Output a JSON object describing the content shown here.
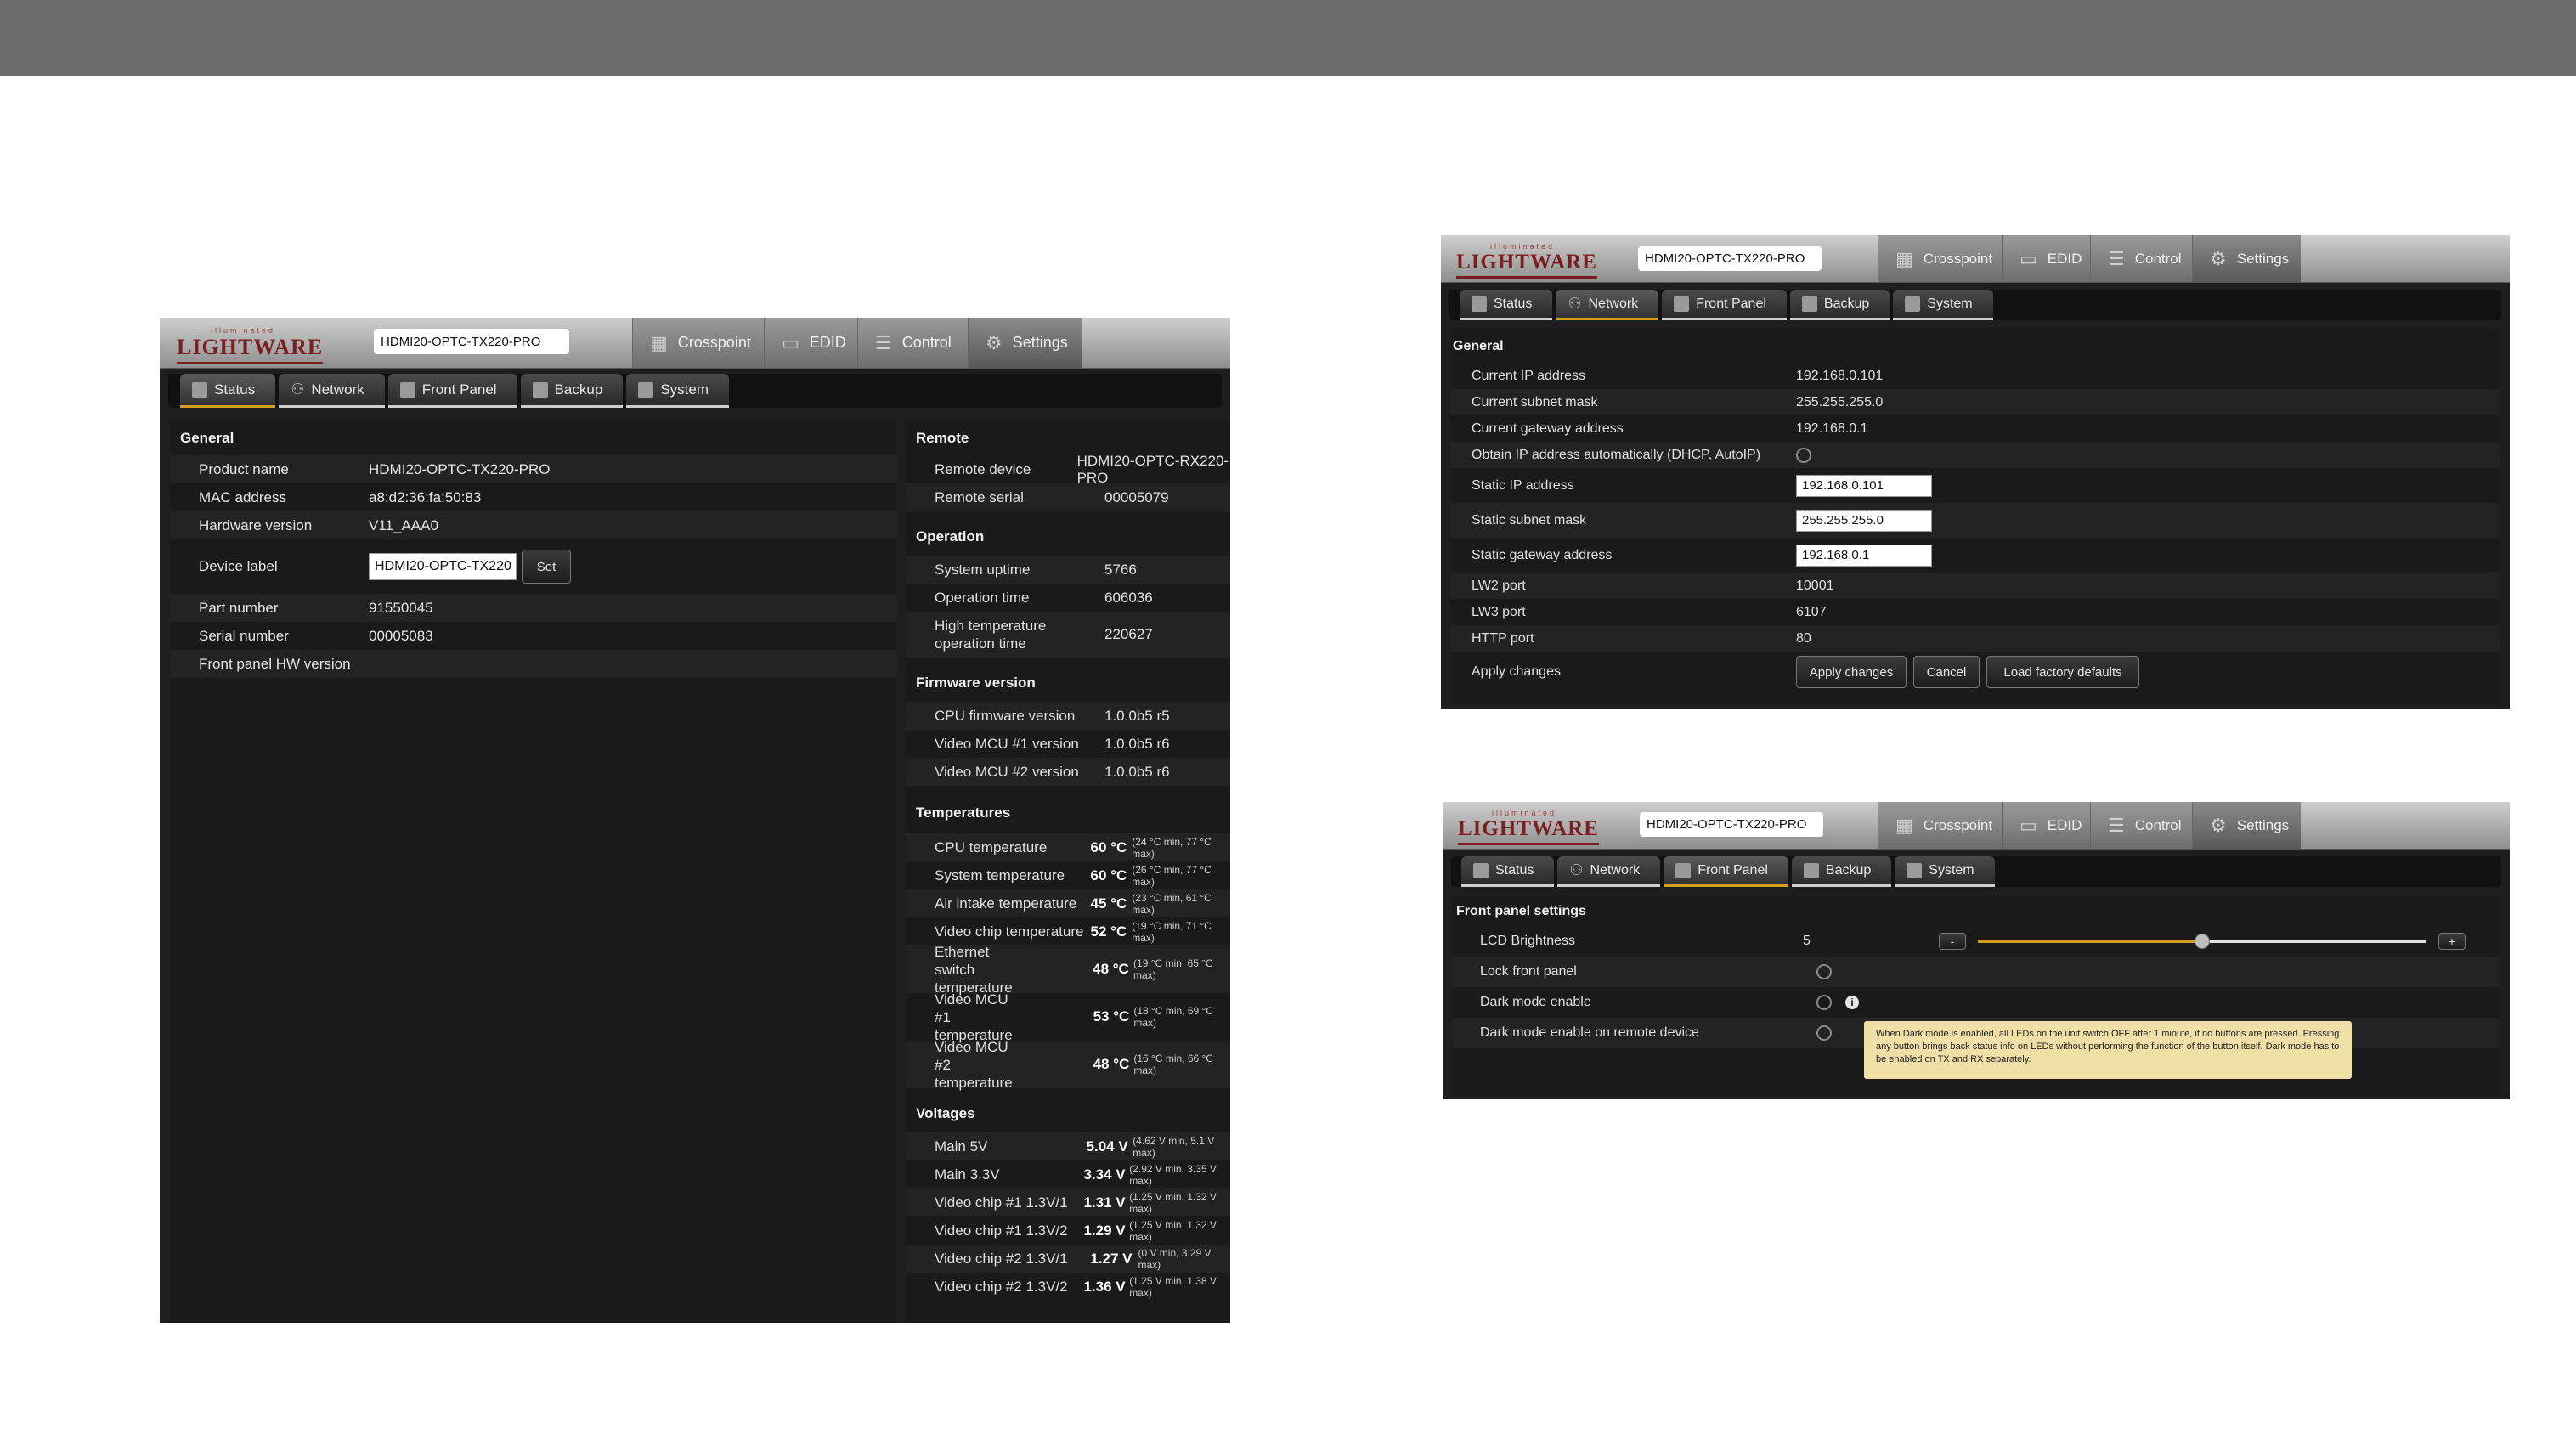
{
  "logo": {
    "tag": "illuminated",
    "name": "LIGHTWARE"
  },
  "device_name": "HDMI20-OPTC-TX220-PRO",
  "nav": [
    "Crosspoint",
    "EDID",
    "Control",
    "Settings"
  ],
  "subtabs": [
    "Status",
    "Network",
    "Front Panel",
    "Backup",
    "System"
  ],
  "status": {
    "general": {
      "title": "General",
      "rows": [
        {
          "label": "Product name",
          "value": "HDMI20-OPTC-TX220-PRO"
        },
        {
          "label": "MAC address",
          "value": "a8:d2:36:fa:50:83"
        },
        {
          "label": "Hardware version",
          "value": "V11_AAA0"
        },
        {
          "label": "Device label",
          "value": "HDMI20-OPTC-TX220",
          "button": "Set"
        },
        {
          "label": "Part number",
          "value": "91550045"
        },
        {
          "label": "Serial number",
          "value": "00005083"
        },
        {
          "label": "Front panel HW version",
          "value": ""
        }
      ]
    },
    "remote": {
      "title": "Remote",
      "rows": [
        {
          "label": "Remote device",
          "value": "HDMI20-OPTC-RX220-PRO"
        },
        {
          "label": "Remote serial",
          "value": "00005079"
        }
      ]
    },
    "operation": {
      "title": "Operation",
      "rows": [
        {
          "label": "System uptime",
          "value": "5766"
        },
        {
          "label": "Operation time",
          "value": "606036"
        },
        {
          "label": "High temperature operation time",
          "value": "220627"
        }
      ]
    },
    "firmware": {
      "title": "Firmware version",
      "rows": [
        {
          "label": "CPU firmware version",
          "value": "1.0.0b5 r5"
        },
        {
          "label": "Video MCU #1 version",
          "value": "1.0.0b5 r6"
        },
        {
          "label": "Video MCU #2 version",
          "value": "1.0.0b5 r6"
        }
      ]
    },
    "temperatures": {
      "title": "Temperatures",
      "rows": [
        {
          "label": "CPU temperature",
          "value": "60 °C",
          "range": "(24 °C min, 77 °C max)"
        },
        {
          "label": "System temperature",
          "value": "60 °C",
          "range": "(26 °C min, 77 °C max)"
        },
        {
          "label": "Air intake temperature",
          "value": "45 °C",
          "range": "(23 °C min, 61 °C max)"
        },
        {
          "label": "Video chip temperature",
          "value": "52 °C",
          "range": "(19 °C min, 71 °C max)"
        },
        {
          "label": "Ethernet switch temperature",
          "value": "48 °C",
          "range": "(19 °C min, 65 °C max)"
        },
        {
          "label": "Video MCU #1 temperature",
          "value": "53 °C",
          "range": "(18 °C min, 69 °C max)"
        },
        {
          "label": "Video MCU #2 temperature",
          "value": "48 °C",
          "range": "(16 °C min, 66 °C max)"
        }
      ]
    },
    "voltages": {
      "title": "Voltages",
      "rows": [
        {
          "label": "Main 5V",
          "value": "5.04 V",
          "range": "(4.62 V min, 5.1 V max)"
        },
        {
          "label": "Main 3.3V",
          "value": "3.34 V",
          "range": "(2.92 V min, 3.35 V max)"
        },
        {
          "label": "Video chip #1 1.3V/1",
          "value": "1.31 V",
          "range": "(1.25 V min, 1.32 V max)"
        },
        {
          "label": "Video chip #1 1.3V/2",
          "value": "1.29 V",
          "range": "(1.25 V min, 1.32 V max)"
        },
        {
          "label": "Video chip #2 1.3V/1",
          "value": "1.27 V",
          "range": "(0 V min, 3.29 V max)"
        },
        {
          "label": "Video chip #2 1.3V/2",
          "value": "1.36 V",
          "range": "(1.25 V min, 1.38 V max)"
        }
      ]
    }
  },
  "network": {
    "title": "General",
    "current_ip": {
      "label": "Current IP address",
      "value": "192.168.0.101"
    },
    "current_mask": {
      "label": "Current subnet mask",
      "value": "255.255.255.0"
    },
    "current_gw": {
      "label": "Current gateway address",
      "value": "192.168.0.1"
    },
    "dhcp": {
      "label": "Obtain IP address automatically (DHCP, AutoIP)"
    },
    "static_ip": {
      "label": "Static IP address",
      "value": "192.168.0.101"
    },
    "static_mask": {
      "label": "Static subnet mask",
      "value": "255.255.255.0"
    },
    "static_gw": {
      "label": "Static gateway address",
      "value": "192.168.0.1"
    },
    "lw2": {
      "label": "LW2 port",
      "value": "10001"
    },
    "lw3": {
      "label": "LW3 port",
      "value": "6107"
    },
    "http": {
      "label": "HTTP port",
      "value": "80"
    },
    "apply": {
      "label": "Apply changes",
      "apply_btn": "Apply changes",
      "cancel_btn": "Cancel",
      "factory_btn": "Load factory defaults"
    }
  },
  "front_panel": {
    "title": "Front panel settings",
    "lcd": {
      "label": "LCD Brightness",
      "value": "5",
      "minus": "-",
      "plus": "+",
      "level": 0.5
    },
    "lock": {
      "label": "Lock front panel"
    },
    "dark": {
      "label": "Dark mode enable",
      "info": "i"
    },
    "dark_remote": {
      "label": "Dark mode enable on remote device"
    },
    "tooltip": "When Dark mode is enabled, all LEDs on the unit switch OFF after 1 minute, if no buttons are pressed. Pressing any button brings back status info on LEDs without performing the function of the button itself. Dark mode has to be enabled on TX and RX separately."
  },
  "colors": {
    "active_tab_underline": "#d4a020",
    "tooltip_bg": "#f0e0a8",
    "slider": "#d4a020"
  }
}
